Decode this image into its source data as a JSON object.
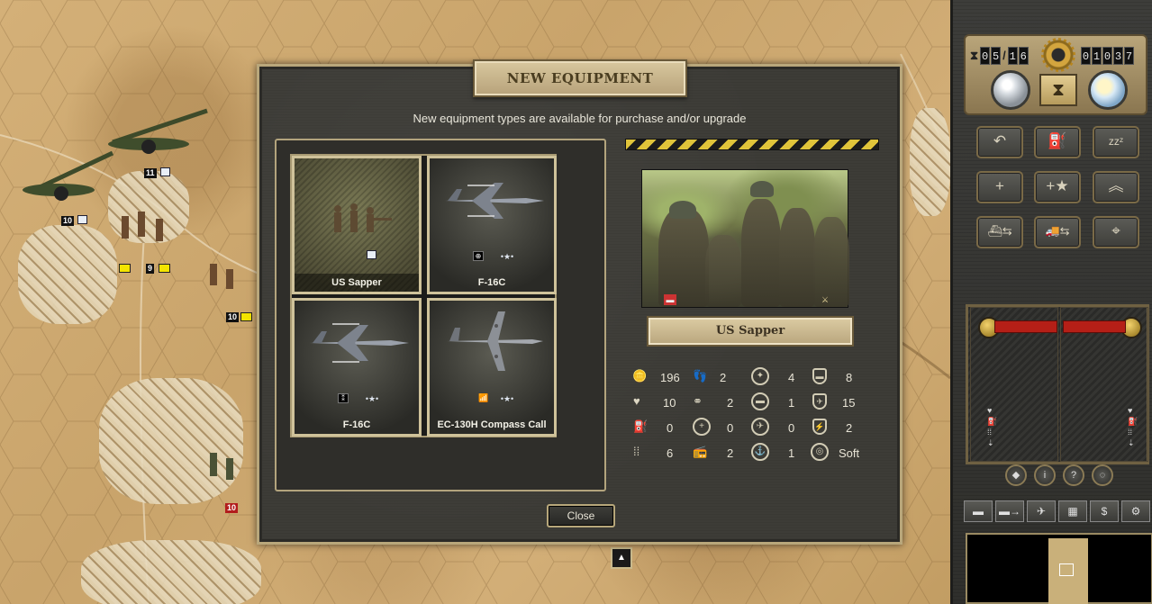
{
  "dialog": {
    "title": "NEW EQUIPMENT",
    "subtitle": "New equipment types are available for purchase and/or upgrade",
    "close_label": "Close",
    "equipment": [
      {
        "name": "US Sapper",
        "selected": true
      },
      {
        "name": "F-16C",
        "selected": false
      },
      {
        "name": "F-16C",
        "selected": false
      },
      {
        "name": "EC-130H Compass Call",
        "selected": false
      }
    ],
    "selected_unit": {
      "name": "US Sapper",
      "stats": [
        {
          "icon": "cost-coins-icon",
          "value": "196"
        },
        {
          "icon": "movement-boots-icon",
          "value": "2"
        },
        {
          "icon": "soft-attack-icon",
          "value": "4"
        },
        {
          "icon": "ground-defense-icon",
          "value": "8"
        },
        {
          "icon": "strength-heart-icon",
          "value": "10"
        },
        {
          "icon": "spotting-binoculars-icon",
          "value": "2"
        },
        {
          "icon": "hard-attack-icon",
          "value": "1"
        },
        {
          "icon": "air-defense-icon",
          "value": "15"
        },
        {
          "icon": "fuel-icon",
          "value": "0"
        },
        {
          "icon": "range-crosshair-icon",
          "value": "0"
        },
        {
          "icon": "air-attack-icon",
          "value": "0"
        },
        {
          "icon": "initiative-icon",
          "value": "2"
        },
        {
          "icon": "ammo-icon",
          "value": "6"
        },
        {
          "icon": "radio-icon",
          "value": "2"
        },
        {
          "icon": "naval-attack-icon",
          "value": "1"
        },
        {
          "icon": "target-type-icon",
          "value": "Soft"
        }
      ]
    }
  },
  "sidebar": {
    "turn_current": [
      "0",
      "5"
    ],
    "turn_total": [
      "1",
      "6"
    ],
    "prestige": [
      "0",
      "1",
      "0",
      "3",
      "7"
    ]
  },
  "map": {
    "unit_labels": [
      "11",
      "10",
      "9",
      "10",
      "10"
    ]
  }
}
